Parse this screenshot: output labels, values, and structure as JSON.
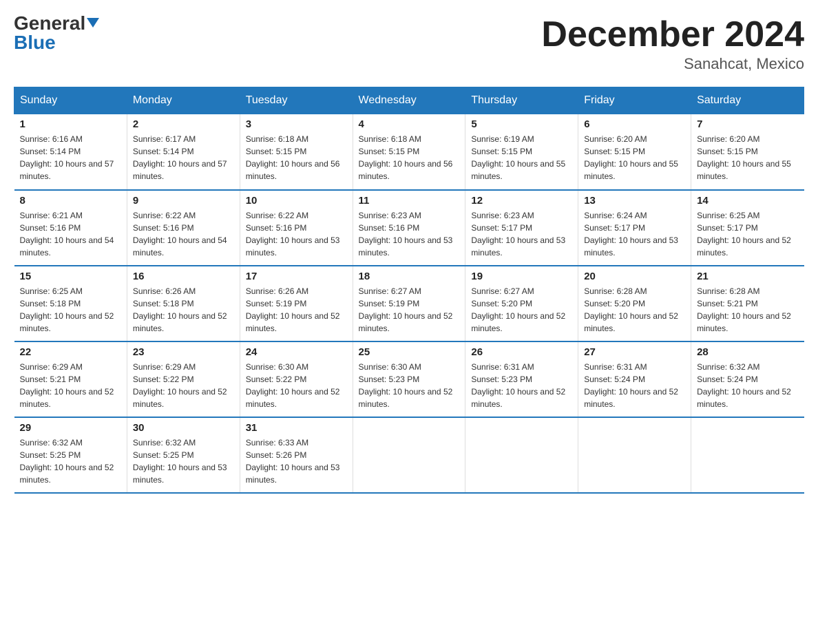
{
  "logo": {
    "general": "General",
    "blue": "Blue",
    "arrow": "▼"
  },
  "title": "December 2024",
  "subtitle": "Sanahcat, Mexico",
  "days_header": [
    "Sunday",
    "Monday",
    "Tuesday",
    "Wednesday",
    "Thursday",
    "Friday",
    "Saturday"
  ],
  "weeks": [
    [
      {
        "day": "1",
        "sunrise": "6:16 AM",
        "sunset": "5:14 PM",
        "daylight": "10 hours and 57 minutes."
      },
      {
        "day": "2",
        "sunrise": "6:17 AM",
        "sunset": "5:14 PM",
        "daylight": "10 hours and 57 minutes."
      },
      {
        "day": "3",
        "sunrise": "6:18 AM",
        "sunset": "5:15 PM",
        "daylight": "10 hours and 56 minutes."
      },
      {
        "day": "4",
        "sunrise": "6:18 AM",
        "sunset": "5:15 PM",
        "daylight": "10 hours and 56 minutes."
      },
      {
        "day": "5",
        "sunrise": "6:19 AM",
        "sunset": "5:15 PM",
        "daylight": "10 hours and 55 minutes."
      },
      {
        "day": "6",
        "sunrise": "6:20 AM",
        "sunset": "5:15 PM",
        "daylight": "10 hours and 55 minutes."
      },
      {
        "day": "7",
        "sunrise": "6:20 AM",
        "sunset": "5:15 PM",
        "daylight": "10 hours and 55 minutes."
      }
    ],
    [
      {
        "day": "8",
        "sunrise": "6:21 AM",
        "sunset": "5:16 PM",
        "daylight": "10 hours and 54 minutes."
      },
      {
        "day": "9",
        "sunrise": "6:22 AM",
        "sunset": "5:16 PM",
        "daylight": "10 hours and 54 minutes."
      },
      {
        "day": "10",
        "sunrise": "6:22 AM",
        "sunset": "5:16 PM",
        "daylight": "10 hours and 53 minutes."
      },
      {
        "day": "11",
        "sunrise": "6:23 AM",
        "sunset": "5:16 PM",
        "daylight": "10 hours and 53 minutes."
      },
      {
        "day": "12",
        "sunrise": "6:23 AM",
        "sunset": "5:17 PM",
        "daylight": "10 hours and 53 minutes."
      },
      {
        "day": "13",
        "sunrise": "6:24 AM",
        "sunset": "5:17 PM",
        "daylight": "10 hours and 53 minutes."
      },
      {
        "day": "14",
        "sunrise": "6:25 AM",
        "sunset": "5:17 PM",
        "daylight": "10 hours and 52 minutes."
      }
    ],
    [
      {
        "day": "15",
        "sunrise": "6:25 AM",
        "sunset": "5:18 PM",
        "daylight": "10 hours and 52 minutes."
      },
      {
        "day": "16",
        "sunrise": "6:26 AM",
        "sunset": "5:18 PM",
        "daylight": "10 hours and 52 minutes."
      },
      {
        "day": "17",
        "sunrise": "6:26 AM",
        "sunset": "5:19 PM",
        "daylight": "10 hours and 52 minutes."
      },
      {
        "day": "18",
        "sunrise": "6:27 AM",
        "sunset": "5:19 PM",
        "daylight": "10 hours and 52 minutes."
      },
      {
        "day": "19",
        "sunrise": "6:27 AM",
        "sunset": "5:20 PM",
        "daylight": "10 hours and 52 minutes."
      },
      {
        "day": "20",
        "sunrise": "6:28 AM",
        "sunset": "5:20 PM",
        "daylight": "10 hours and 52 minutes."
      },
      {
        "day": "21",
        "sunrise": "6:28 AM",
        "sunset": "5:21 PM",
        "daylight": "10 hours and 52 minutes."
      }
    ],
    [
      {
        "day": "22",
        "sunrise": "6:29 AM",
        "sunset": "5:21 PM",
        "daylight": "10 hours and 52 minutes."
      },
      {
        "day": "23",
        "sunrise": "6:29 AM",
        "sunset": "5:22 PM",
        "daylight": "10 hours and 52 minutes."
      },
      {
        "day": "24",
        "sunrise": "6:30 AM",
        "sunset": "5:22 PM",
        "daylight": "10 hours and 52 minutes."
      },
      {
        "day": "25",
        "sunrise": "6:30 AM",
        "sunset": "5:23 PM",
        "daylight": "10 hours and 52 minutes."
      },
      {
        "day": "26",
        "sunrise": "6:31 AM",
        "sunset": "5:23 PM",
        "daylight": "10 hours and 52 minutes."
      },
      {
        "day": "27",
        "sunrise": "6:31 AM",
        "sunset": "5:24 PM",
        "daylight": "10 hours and 52 minutes."
      },
      {
        "day": "28",
        "sunrise": "6:32 AM",
        "sunset": "5:24 PM",
        "daylight": "10 hours and 52 minutes."
      }
    ],
    [
      {
        "day": "29",
        "sunrise": "6:32 AM",
        "sunset": "5:25 PM",
        "daylight": "10 hours and 52 minutes."
      },
      {
        "day": "30",
        "sunrise": "6:32 AM",
        "sunset": "5:25 PM",
        "daylight": "10 hours and 53 minutes."
      },
      {
        "day": "31",
        "sunrise": "6:33 AM",
        "sunset": "5:26 PM",
        "daylight": "10 hours and 53 minutes."
      },
      null,
      null,
      null,
      null
    ]
  ]
}
